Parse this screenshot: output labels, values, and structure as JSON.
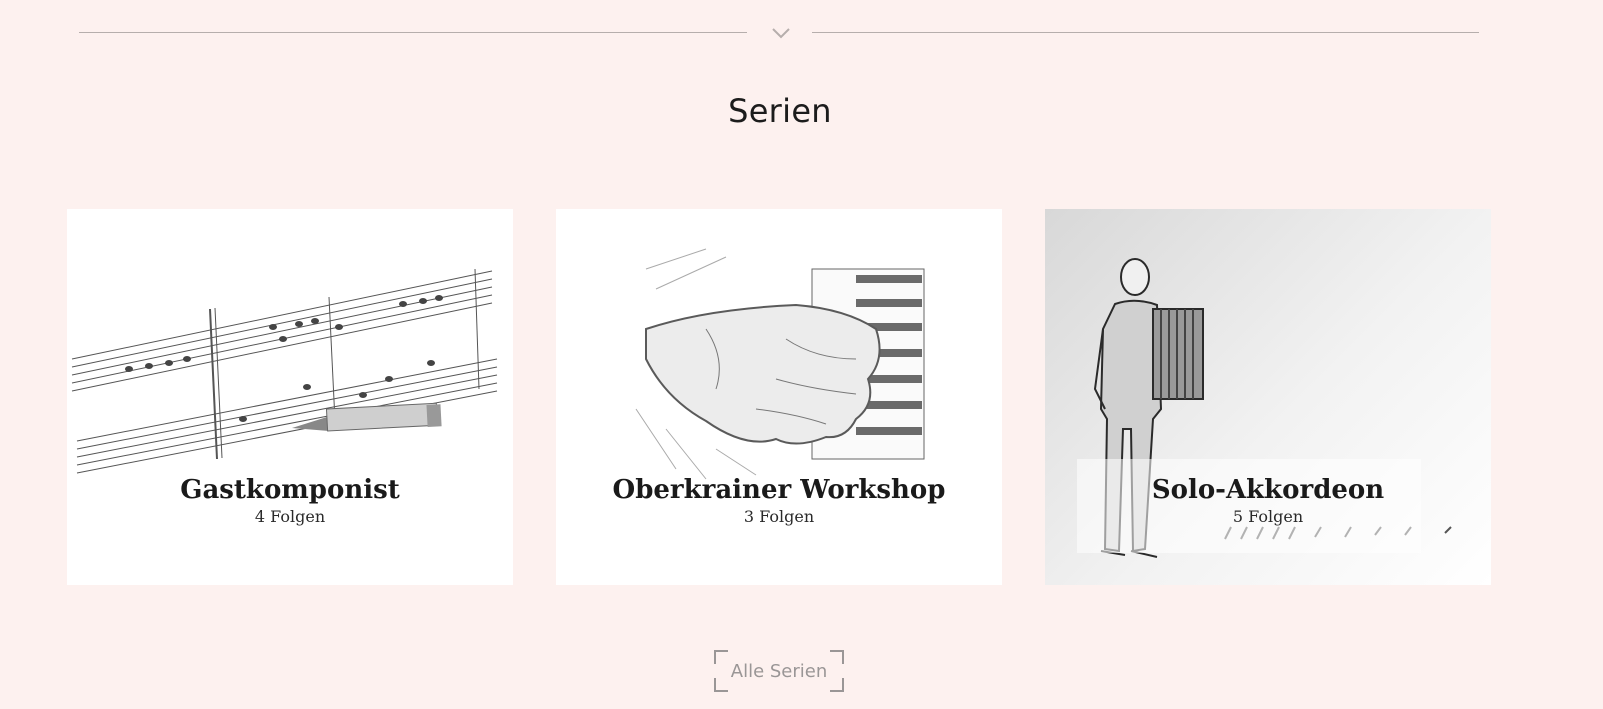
{
  "section": {
    "title": "Serien",
    "divider_icon": "chevron-down-icon"
  },
  "cards": [
    {
      "name": "Gastkomponist",
      "count": "4 Folgen",
      "image": "sheet-music-pencil-sketch"
    },
    {
      "name": "Oberkrainer Workshop",
      "count": "3 Folgen",
      "image": "hand-on-keyboard-sketch"
    },
    {
      "name": "Solo-Akkordeon",
      "count": "5 Folgen",
      "image": "accordion-player-sketch"
    }
  ],
  "more_button": {
    "label": "Alle Serien"
  },
  "colors": {
    "background": "#fdf1ef",
    "divider": "#b6aeac",
    "button_text": "#9a9696"
  }
}
